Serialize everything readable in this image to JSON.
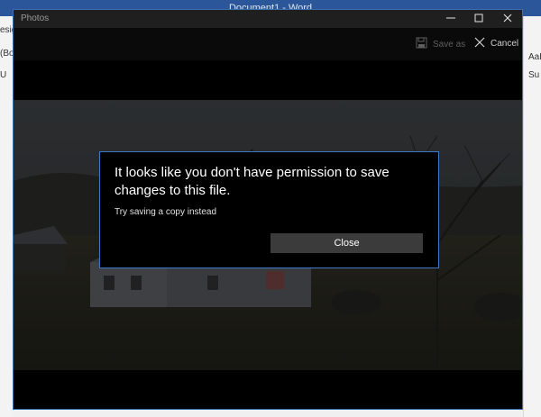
{
  "word": {
    "title": "Document1 - Word",
    "left_fragments": [
      "esig",
      "(Bo",
      "U"
    ],
    "right_fragments": [
      "AaB",
      "Su"
    ]
  },
  "photos": {
    "title": "Photos",
    "toolbar": {
      "save_as_label": "Save as",
      "cancel_label": "Cancel"
    }
  },
  "dialog": {
    "title": "It looks like you don't have permission to save changes to this file.",
    "message": "Try saving a copy instead",
    "close_label": "Close"
  },
  "icons": [
    "minimize-icon",
    "maximize-icon",
    "close-icon",
    "save-as-icon",
    "cancel-icon"
  ],
  "colors": {
    "word_brand": "#2b579a",
    "window_border": "#3a6fb0",
    "dialog_border": "#3e78c7",
    "close_button_bg": "#3b3b3b"
  }
}
